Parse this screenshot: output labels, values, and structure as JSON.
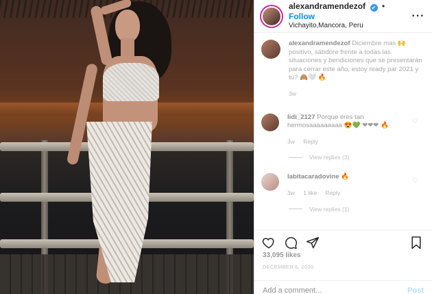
{
  "header": {
    "username": "alexandramendezof",
    "verified_mark": "✔",
    "separator": "•",
    "follow_label": "Follow",
    "location": "Vichayito,Mancora, Peru",
    "more_label": "···"
  },
  "caption": {
    "username": "alexandramendezof",
    "text": "Diciembre mas 🙌 positivo, sábdore frente a todas las situaciones y bendiciones que se presentarán para cerrar este año, estoy ready par 2021 y tú? 🙈🤍 🔥",
    "time": "3w"
  },
  "comments": [
    {
      "username": "lidi_2127",
      "text": "Porque eres tan hermosaaaaaaaaa 😍💚 ❤❤❤ 🔥",
      "time": "3w",
      "reply_label": "Reply",
      "view_replies": "View replies (3)"
    },
    {
      "username": "labitacaradovine",
      "text": "🔥",
      "time": "3w",
      "likes": "1 like",
      "reply_label": "Reply",
      "view_replies": "View replies (1)"
    }
  ],
  "post": {
    "likes": "33,095 likes",
    "date": "DECEMBER 6, 2020"
  },
  "add_comment": {
    "placeholder": "Add a comment...",
    "post_label": "Post"
  },
  "icons": [
    "heart-icon",
    "comment-icon",
    "share-icon",
    "save-icon",
    "more-icon",
    "verified-icon"
  ],
  "colors": {
    "follow": "#0095f6",
    "post_disabled": "#b2dffc",
    "verified": "#3897f0"
  }
}
